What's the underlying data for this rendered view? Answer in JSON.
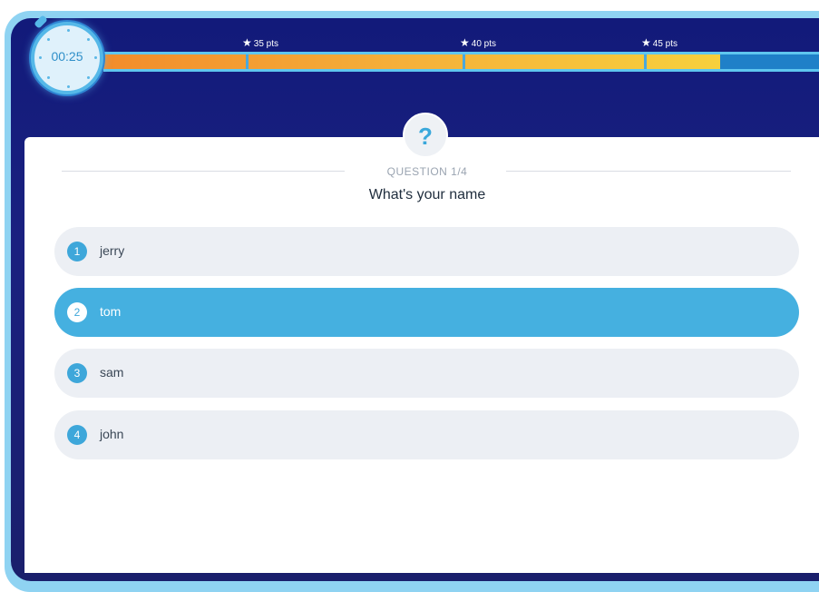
{
  "timer": {
    "value": "00:25",
    "progress_fraction": 0.85
  },
  "milestones": [
    {
      "label": "35 pts",
      "position_fraction": 0.19
    },
    {
      "label": "40 pts",
      "position_fraction": 0.49
    },
    {
      "label": "45 pts",
      "position_fraction": 0.74
    }
  ],
  "question": {
    "number_label": "QUESTION 1/4",
    "text": "What's your name",
    "icon_glyph": "?"
  },
  "options": [
    {
      "number": "1",
      "label": "jerry",
      "selected": false
    },
    {
      "number": "2",
      "label": "tom",
      "selected": true
    },
    {
      "number": "3",
      "label": "sam",
      "selected": false
    },
    {
      "number": "4",
      "label": "john",
      "selected": false
    }
  ],
  "colors": {
    "header_bg": "#1a1f6c",
    "accent": "#45b0e0",
    "bar_start": "#f28c2b",
    "bar_end": "#f7d03c",
    "option_bg": "#eceff4"
  },
  "icons": {
    "timer": "stopwatch-icon",
    "milestone": "star-icon",
    "question": "question-mark-icon"
  }
}
